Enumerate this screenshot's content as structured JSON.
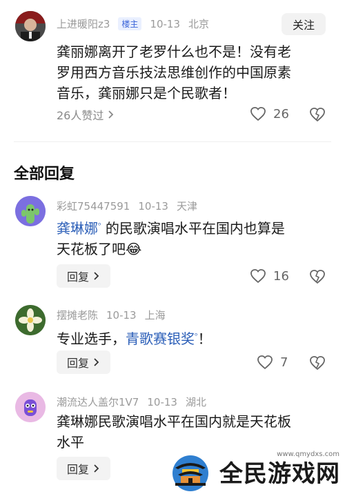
{
  "post": {
    "username": "上进暖阳z3",
    "badge": "楼主",
    "date": "10-13",
    "location": "北京",
    "follow_label": "关注",
    "text_line1": "龚丽娜离开了老罗什么也不是！没有老",
    "text_line2": "罗用西方音乐技法思维创作的中国原素",
    "text_line3": "音乐，龚丽娜只是个民歌者！",
    "likers": "26人赞过",
    "likes": "26"
  },
  "section_title": "全部回复",
  "replies": [
    {
      "username": "彩虹75447591",
      "date": "10-13",
      "location": "天津",
      "mention": "龚琳娜",
      "text_after_mention": "的民歌演唱水平在国内也算是",
      "text_line2": "天花板了吧",
      "emoji": "😂",
      "reply_label": "回复",
      "likes": "16"
    },
    {
      "username": "摆摊老陈",
      "date": "10-13",
      "location": "上海",
      "text_before": "专业选手，",
      "mention": "青歌赛银奖",
      "text_after": "！",
      "reply_label": "回复",
      "likes": "7"
    },
    {
      "username": "潮流达人盖尔1V7",
      "date": "10-13",
      "location": "湖北",
      "text_line1": "龚琳娜民歌演唱水平在国内就是天花板",
      "text_line2": "水平",
      "reply_label": "回复"
    }
  ],
  "watermark": {
    "text": "全民游戏网",
    "url": "www.qmydxs.com"
  },
  "colors": {
    "link": "#2c5fb8",
    "badge_bg": "#eaf0ff",
    "badge_text": "#3a64d8",
    "meta": "#9a9a9a"
  }
}
